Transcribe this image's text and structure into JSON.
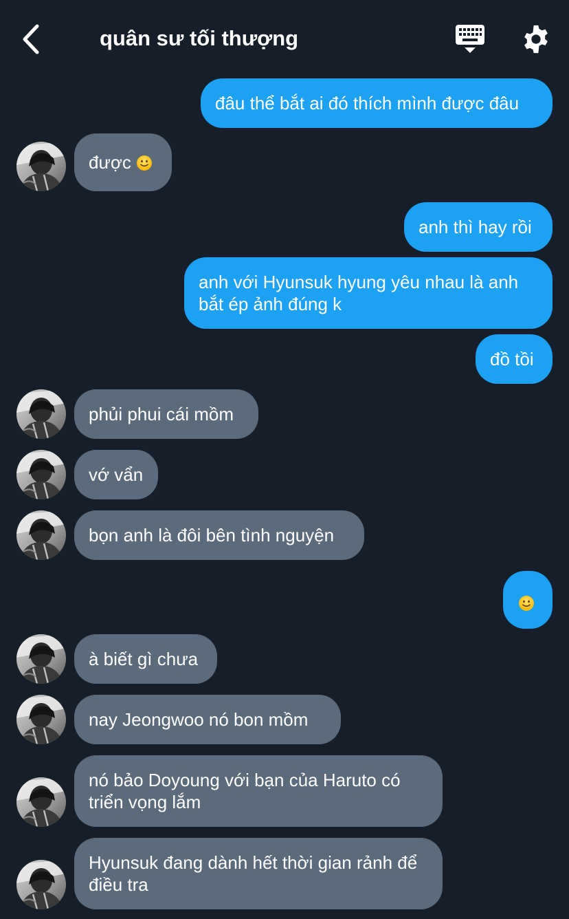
{
  "header": {
    "title": "quân sư tối thượng",
    "back_icon": "chevron-left-icon",
    "keyboard_icon": "keyboard-icon",
    "settings_icon": "gear-icon"
  },
  "colors": {
    "background": "#161e29",
    "outgoing_bubble": "#1da1f2",
    "incoming_bubble": "#5c6b7c"
  },
  "messages": [
    {
      "direction": "outgoing",
      "text": "đâu thể bắt ai đó thích mình được đâu"
    },
    {
      "direction": "incoming",
      "text": "được",
      "emoji": "slightly-smiling-face"
    },
    {
      "direction": "outgoing",
      "text": "anh thì hay rồi"
    },
    {
      "direction": "outgoing",
      "text": "anh với Hyunsuk hyung yêu nhau là anh bắt ép ảnh đúng k"
    },
    {
      "direction": "outgoing",
      "text": "đồ tồi"
    },
    {
      "direction": "incoming",
      "text": "phủi phui cái mồm"
    },
    {
      "direction": "incoming",
      "text": "vớ vẩn"
    },
    {
      "direction": "incoming",
      "text": "bọn anh là đôi bên tình nguyện"
    },
    {
      "direction": "outgoing",
      "text": "",
      "emoji": "slightly-smiling-face"
    },
    {
      "direction": "incoming",
      "text": "à biết gì chưa"
    },
    {
      "direction": "incoming",
      "text": "nay Jeongwoo nó bon mồm"
    },
    {
      "direction": "incoming",
      "text": "nó bảo Doyoung với bạn của Haruto có triển vọng lắm"
    },
    {
      "direction": "incoming",
      "text": "Hyunsuk đang dành hết thời gian rảnh để điều tra"
    }
  ]
}
